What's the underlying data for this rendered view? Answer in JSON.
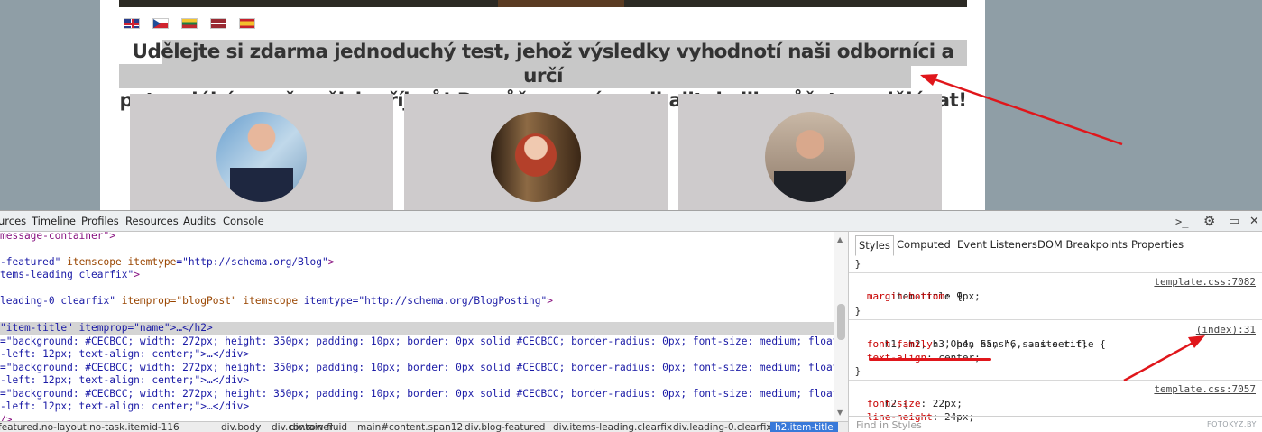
{
  "page": {
    "headline_line1": "Udělejte si zdarma jednoduchý test, jehož výsledky vyhodnotí naši odborníci a určí",
    "headline_line2": "potenciál úrovně vašich příjmů! Pomůžeme vám odhalit, kolik můžete vydělávat!",
    "flags": [
      "flag-uk-icon",
      "flag-cz-icon",
      "flag-lt-icon",
      "flag-lv-icon",
      "flag-es-icon"
    ]
  },
  "devtools": {
    "tabs": [
      "urces",
      "Timeline",
      "Profiles",
      "Resources",
      "Audits",
      "Console"
    ],
    "toolbar_icons": [
      "console-drawer-icon",
      "gear-icon",
      "dock-icon",
      "close-icon"
    ],
    "elements": [
      {
        "kind": "plain",
        "text": "message-container\">"
      },
      {
        "kind": "plain",
        "text": ""
      },
      {
        "kind": "tag",
        "p1": "-featured\"",
        "p2": " itemscope ",
        "p3": "itemtype",
        "p4": "=\"http://schema.org/Blog\"",
        "p5": ">"
      },
      {
        "kind": "tag",
        "p1": "tems-leading clearfix\"",
        "p2": "",
        "p3": "",
        "p4": "",
        "p5": ">"
      },
      {
        "kind": "plain",
        "text": ""
      },
      {
        "kind": "tag",
        "p1": "leading-0 clearfix\"",
        "p2": " itemprop",
        "p3": "=\"blogPost\" itemscope ",
        "p4": "itemtype=\"http://schema.org/BlogPosting\"",
        "p5": ">"
      },
      {
        "kind": "plain",
        "text": ""
      },
      {
        "kind": "sel",
        "text": "\"item-title\" itemprop=\"name\">…</h2>"
      },
      {
        "kind": "style",
        "text": "=\"background: #CECBCC; width: 272px; height: 350px; padding: 10px; border: 0px solid #CECBCC; border-radius: 0px; font-size: medium; float:"
      },
      {
        "kind": "style",
        "text": "-left: 12px; text-align: center;\">…</div>"
      },
      {
        "kind": "style",
        "text": "=\"background: #CECBCC; width: 272px; height: 350px; padding: 10px; border: 0px solid #CECBCC; border-radius: 0px; font-size: medium; float:"
      },
      {
        "kind": "style",
        "text": "-left: 12px; text-align: center;\">…</div>"
      },
      {
        "kind": "style",
        "text": "=\"background: #CECBCC; width: 272px; height: 350px; padding: 10px; border: 0px solid #CECBCC; border-radius: 0px; font-size: medium; float:"
      },
      {
        "kind": "style",
        "text": "-left: 12px; text-align: center;\">…</div>"
      },
      {
        "kind": "plain",
        "text": "/>"
      }
    ],
    "breadcrumbs": [
      "featured.no-layout.no-task.itemid-116",
      "div.body",
      "div.container",
      "div.row-fluid",
      "main#content.span12",
      "div.blog-featured",
      "div.items-leading.clearfix",
      "div.leading-0.clearfix",
      "h2.item-title"
    ],
    "styles_tabs": [
      "Styles",
      "Computed",
      "Event Listeners",
      "DOM Breakpoints",
      "Properties"
    ],
    "rules": [
      {
        "selector": ".item-title {",
        "source": "template.css:7082",
        "props": [
          {
            "name": "margin-bottom",
            "value": "9px;"
          }
        ]
      },
      {
        "selector": "h1, h2, h3, h4, h5, h6, .site-title {",
        "source": "(index):31",
        "props": [
          {
            "name": "font-family",
            "value": "'Open Sans', sans-serif;"
          },
          {
            "name": "text-align",
            "value": "center;"
          }
        ]
      },
      {
        "selector": "h2 {",
        "source": "template.css:7057",
        "props": [
          {
            "name": "font-size",
            "value": "22px;"
          },
          {
            "name": "line-height",
            "value": "24px;"
          }
        ]
      }
    ],
    "find_placeholder": "Find in Styles",
    "watermark": "FOTOKYZ.BY"
  },
  "colors": {
    "card_bg": "#CECBCC",
    "annotation_red": "#e0161b",
    "selected_crumb": "#3879d9"
  }
}
